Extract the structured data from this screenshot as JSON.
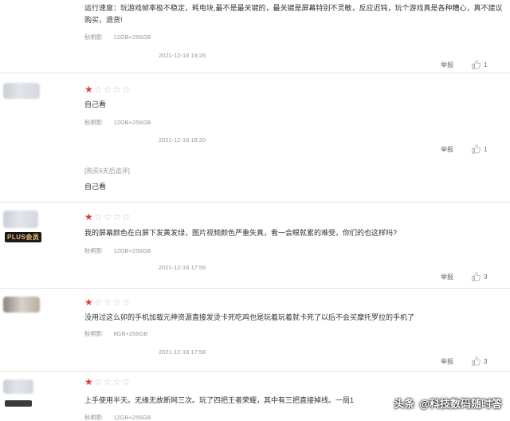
{
  "reviews": [
    {
      "text": "运行速度：玩游戏帧率极不稳定，耗电块,最不是最关键的，最关键是屏幕特别不灵敏，反应迟钝，玩个游戏真是各种糟心，真不建议购买，退货!",
      "color": "秋桐影",
      "spec": "12GB+256GB",
      "date": "2021-12-16 19:26",
      "report": "举报",
      "likes": "1"
    },
    {
      "stars": "1",
      "text": "自己看",
      "color": "秋桐影",
      "spec": "12GB+256GB",
      "date": "2021-12-16 18:20",
      "report": "举报",
      "likes": "1",
      "append_label": "[购买6天后追评]",
      "append_text": "自己看"
    },
    {
      "stars": "1",
      "badge": "PLUS会员",
      "text": "我的屏幕颜色在白屏下发黄发绿，图片视频颜色严重失真，看一会眼就累的难受，你们的也这样吗?",
      "color": "秋桐影",
      "spec": "12GB+256GB",
      "date": "2021-12-16 17:59",
      "report": "举报",
      "likes": "3"
    },
    {
      "stars": "1",
      "text": "没用过这么卯的手机加载元神资源直接发烫卡死吃鸡也是玩着玩着就卡死了以后不会买摩托罗拉的手机了",
      "color": "秋桐影",
      "spec": "8GB+256GB",
      "date": "2021-12-16 17:58",
      "report": "举报",
      "likes": "3"
    },
    {
      "stars": "1",
      "text": "上手使用半天。无缘无故断网三次。玩了四把王者荣耀，其中有三把直接掉线。一局1",
      "color": "秋桐影",
      "spec": "12GB+256GB"
    }
  ],
  "watermark": {
    "brand": "头条",
    "author": "@科技数码随时答"
  },
  "colors": {
    "star_on": "#e4393c",
    "star_off": "#c8c8c8"
  }
}
